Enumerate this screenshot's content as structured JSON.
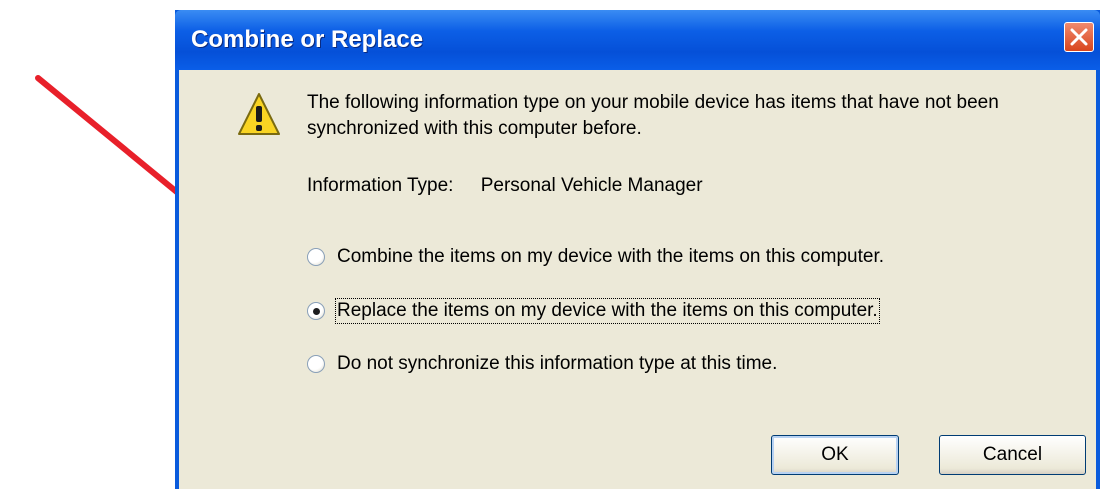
{
  "dialog": {
    "title": "Combine or Replace",
    "message": "The following information type on your mobile device has items that have not been synchronized with this computer before.",
    "info_label": "Information Type:",
    "info_value": "Personal Vehicle Manager",
    "options": [
      {
        "label": "Combine the items on my device with the items on this computer.",
        "selected": false
      },
      {
        "label": "Replace the items on my device with the items on this computer.",
        "selected": true
      },
      {
        "label": "Do not synchronize this information type at this time.",
        "selected": false
      }
    ],
    "ok_label": "OK",
    "cancel_label": "Cancel"
  },
  "icons": [
    "warning-icon",
    "close-icon",
    "arrow-annotation"
  ],
  "colors": {
    "titlebar": "#0a5bdc",
    "client_bg": "#ece9d8",
    "arrow": "#e8202a",
    "close": "#e0502a"
  }
}
